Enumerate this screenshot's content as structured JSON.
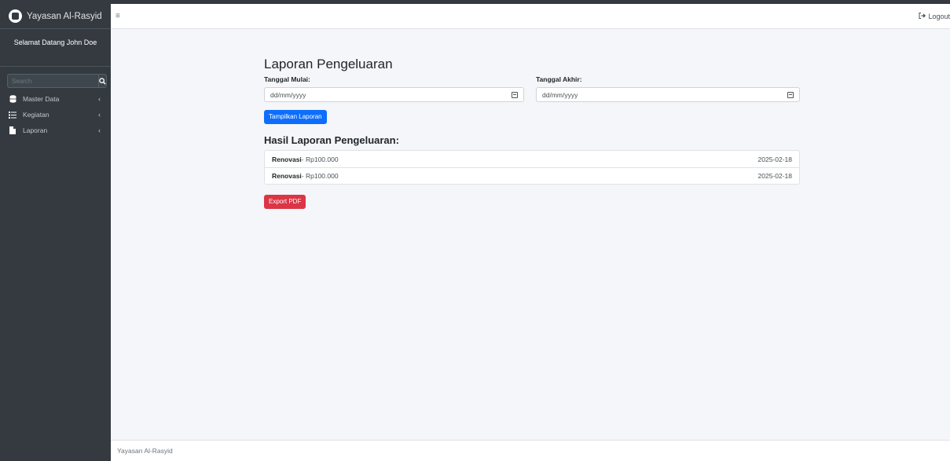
{
  "sidebar": {
    "brand": "Yayasan Al-Rasyid",
    "welcome": "Selamat Datang John Doe",
    "search_placeholder": "Search",
    "items": [
      {
        "label": "Master Data",
        "icon": "database-icon"
      },
      {
        "label": "Kegiatan",
        "icon": "list-icon"
      },
      {
        "label": "Laporan",
        "icon": "file-icon"
      }
    ]
  },
  "header": {
    "menu_icon": "hamburger-icon",
    "logout_label": "Logout"
  },
  "main": {
    "title": "Laporan Pengeluaran",
    "start_label": "Tanggal Mulai:",
    "start_placeholder": "dd/mm/yyyy",
    "end_label": "Tanggal Akhir:",
    "end_placeholder": "dd/mm/yyyy",
    "show_button": "Tampilkan Laporan",
    "result_title": "Hasil Laporan Pengeluaran:",
    "results": [
      {
        "name": "Renovasi",
        "amount": " - Rp100.000",
        "date": "2025-02-18"
      },
      {
        "name": "Renovasi",
        "amount": " - Rp100.000",
        "date": "2025-02-18"
      }
    ],
    "export_button": "Export PDF"
  },
  "footer": {
    "text": "Yayasan Al-Rasyid"
  },
  "colors": {
    "sidebar_bg": "#343a40",
    "primary": "#0d6efd",
    "danger": "#dc3545"
  }
}
